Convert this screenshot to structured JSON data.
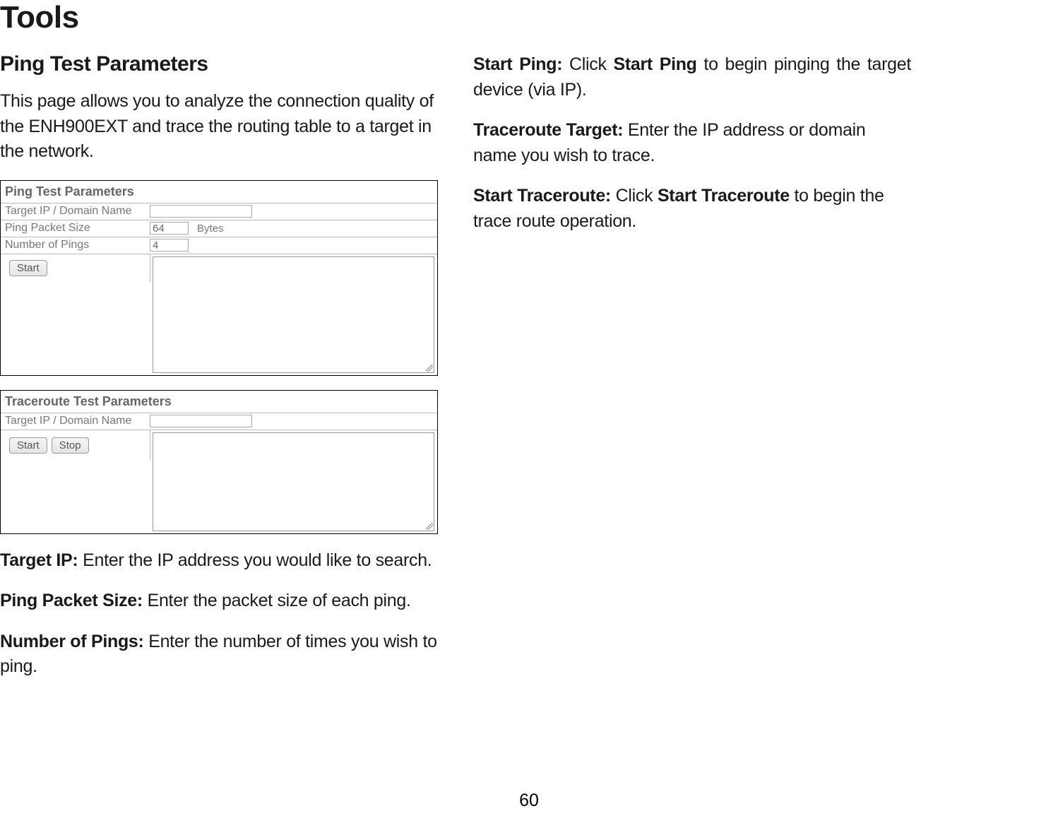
{
  "page_title": "Tools",
  "section_title": "Ping Test Parameters",
  "intro_paragraph": "This page allows you to analyze the connection quality of the ENH900EXT and trace the routing table to a target in the network.",
  "ping_panel": {
    "title": "Ping Test Parameters",
    "row1_label": "Target IP / Domain Name",
    "row1_value": "",
    "row2_label": "Ping Packet Size",
    "row2_value": "64",
    "row2_unit": "Bytes",
    "row3_label": "Number of Pings",
    "row3_value": "4",
    "start_button": "Start"
  },
  "trace_panel": {
    "title": "Traceroute Test Parameters",
    "row1_label": "Target IP / Domain Name",
    "row1_value": "",
    "start_button": "Start",
    "stop_button": "Stop"
  },
  "descriptions": {
    "target_ip_label": "Target IP:",
    "target_ip_text": " Enter the IP address you would like to search.",
    "packet_size_label": "Ping Packet Size:",
    "packet_size_text": " Enter the packet size of each ping.",
    "number_pings_label": "Number of Pings:",
    "number_pings_text": " Enter the number of times you wish to ping.",
    "start_ping_label": "Start Ping:",
    "start_ping_text_a": " Click ",
    "start_ping_bold": "Start Ping",
    "start_ping_text_b": " to begin pinging the target device (via IP).",
    "traceroute_target_label": "Traceroute Target:",
    "traceroute_target_text": " Enter the IP address or domain name you wish to trace.",
    "start_traceroute_label": "Start Traceroute:",
    "start_traceroute_text_a": " Click ",
    "start_traceroute_bold": "Start Traceroute",
    "start_traceroute_text_b": " to begin the trace route operation."
  },
  "page_number": "60"
}
